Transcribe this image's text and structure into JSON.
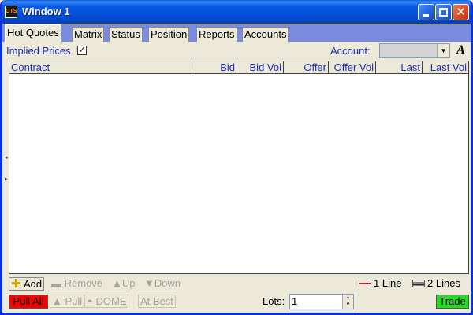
{
  "window": {
    "title": "Window 1",
    "app_icon_text": "OTS"
  },
  "tabs": [
    {
      "label": "Hot Quotes",
      "active": true
    },
    {
      "label": "Matrix",
      "active": false
    },
    {
      "label": "Status",
      "active": false
    },
    {
      "label": "Position",
      "active": false
    },
    {
      "label": "Reports",
      "active": false
    },
    {
      "label": "Accounts",
      "active": false
    }
  ],
  "toolbar": {
    "implied_prices_label": "Implied Prices",
    "implied_prices_checked": true,
    "account_label": "Account:",
    "account_value": "",
    "font_button": "A"
  },
  "grid": {
    "columns": [
      "Contract",
      "Bid",
      "Bid Vol",
      "Offer",
      "Offer Vol",
      "Last",
      "Last Vol"
    ],
    "rows": []
  },
  "actions_row1": {
    "add": "Add",
    "remove": "Remove",
    "up": "Up",
    "down": "Down",
    "one_line": "1 Line",
    "two_lines": "2 Lines"
  },
  "actions_row2": {
    "pull_all": "Pull All",
    "pull": "Pull",
    "dome": "DOME",
    "at_best": "At Best",
    "lots_label": "Lots:",
    "lots_value": "1",
    "trade": "Trade"
  },
  "colors": {
    "pull_all_bg": "#ff0000",
    "trade_bg": "#22dd22",
    "label_blue": "#1a2eb8"
  }
}
